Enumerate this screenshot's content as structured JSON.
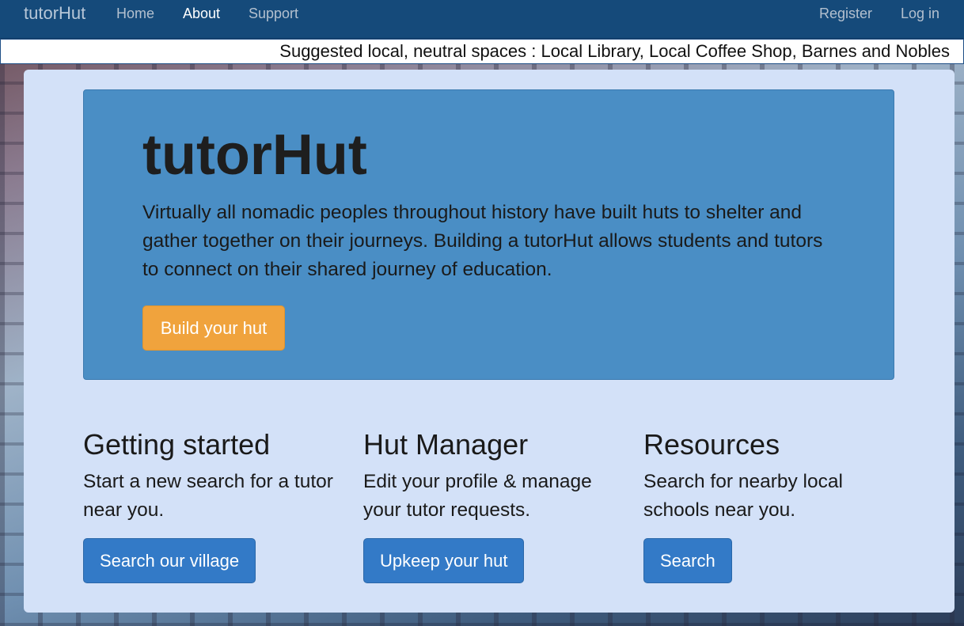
{
  "nav": {
    "brand": "tutorHut",
    "links": [
      "Home",
      "About",
      "Support"
    ],
    "right_links": [
      "Register",
      "Log in"
    ],
    "active": "About"
  },
  "ticker": "Suggested local, neutral spaces : Local Library, Local Coffee Shop, Barnes and Nobles",
  "hero": {
    "title": "tutorHut",
    "text": "Virtually all nomadic peoples throughout history have built huts to shelter and gather together on their journeys. Building a tutorHut allows students and tutors to connect on their shared journey of education.",
    "button": "Build your hut"
  },
  "columns": [
    {
      "title": "Getting started",
      "text": "Start a new search for a tutor near you.",
      "button": "Search our village"
    },
    {
      "title": "Hut Manager",
      "text": "Edit your profile & manage your tutor requests.",
      "button": "Upkeep your hut"
    },
    {
      "title": "Resources",
      "text": "Search for nearby local schools near you.",
      "button": "Search"
    }
  ],
  "colors": {
    "navbar": "#154a7a",
    "jumbotron": "#4a8ec5",
    "warning_button": "#f0a33d",
    "primary_button": "#337ac7",
    "container": "#d3e1f8"
  }
}
